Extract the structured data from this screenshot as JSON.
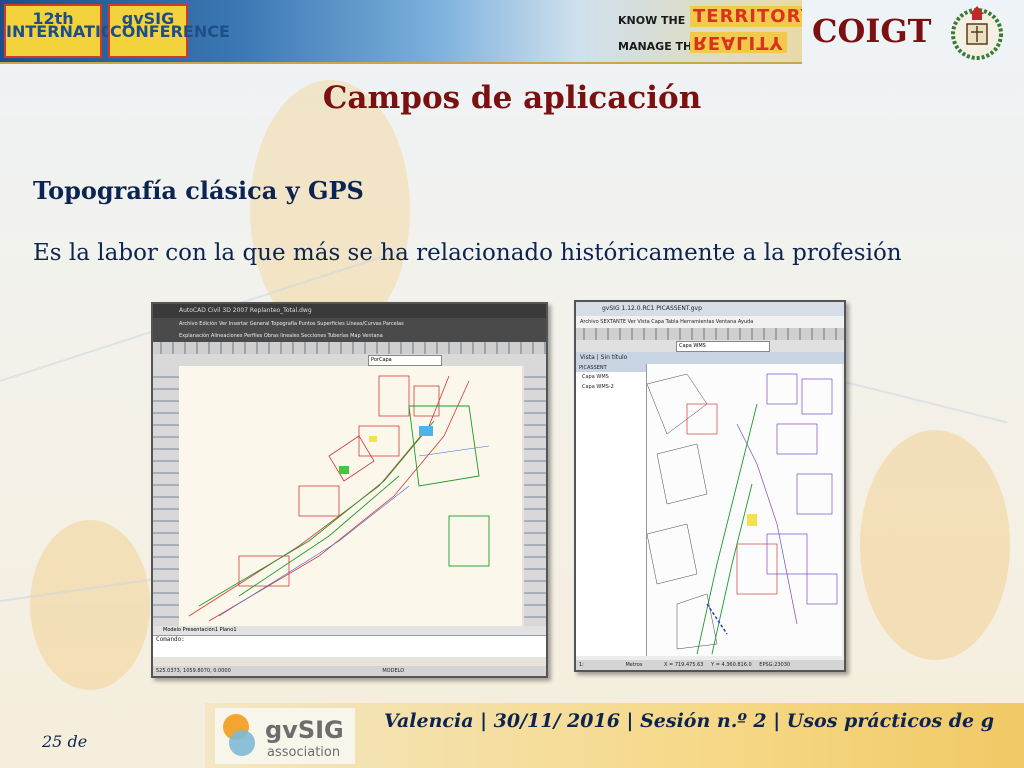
{
  "header": {
    "badge_conference_1": "12th INTERNATIONAL",
    "badge_conference_2": "gvSIG CONFERENCE",
    "motto_1_small": "KNOW THE",
    "motto_1_large": "TERRITORY",
    "motto_2_small": "MANAGE THE",
    "motto_2_large": "REALITY",
    "org": "COIGT"
  },
  "slide": {
    "title": "Campos de aplicación",
    "subtitle": "Topografía clásica y GPS",
    "body": "Es la labor con la que más se ha relacionado históricamente a la profesión"
  },
  "screenshot_cad": {
    "title": "AutoCAD Civil 3D 2007  Replanteo_Total.dwg",
    "menu": "Archivo  Edición  Ver  Insertar  General  Topografía  Puntos  Superficies  Líneas/Curvas  Parcelas",
    "menu2": "Explanación  Alineaciones  Perfiles  Obras lineales  Secciones  Tuberías  Map  Ventana",
    "layer": "PorCapa",
    "layout_tabs": "Modelo  Presentación1  Plano1",
    "command": "Comando:",
    "coords": "525.0373, 1059.8070, 0.0000",
    "status": "MODELO"
  },
  "screenshot_gvsig": {
    "title": "gvSIG 1.12.0.RC1  PICASSENT.gvp",
    "menu": "Archivo  SEXTANTE  Ver  Vista  Capa  Tabla  Herramientas  Ventana  Ayuda",
    "layer_combo": "Capa WMS",
    "view_title": "Vista | Sin título",
    "toc_items": [
      "PICASSENT",
      "Capa WMS",
      "Capa WMS-2"
    ],
    "scale": "1:",
    "units": "Metros",
    "status_x": "X = 719.475.63",
    "status_y": "Y = 4.360.816.0",
    "epsg": "EPSG:23030"
  },
  "footer": {
    "logo_word": "gvSIG",
    "logo_sub": "association",
    "text": "Valencia | 30/11/ 2016 | Sesión n.º 2 | Usos prácticos de g",
    "page": "25 de"
  },
  "colors": {
    "title_red": "#7a1010",
    "navy": "#0c2550",
    "banner_blue": "#1d4f86",
    "accent_orange": "#f3a531"
  }
}
